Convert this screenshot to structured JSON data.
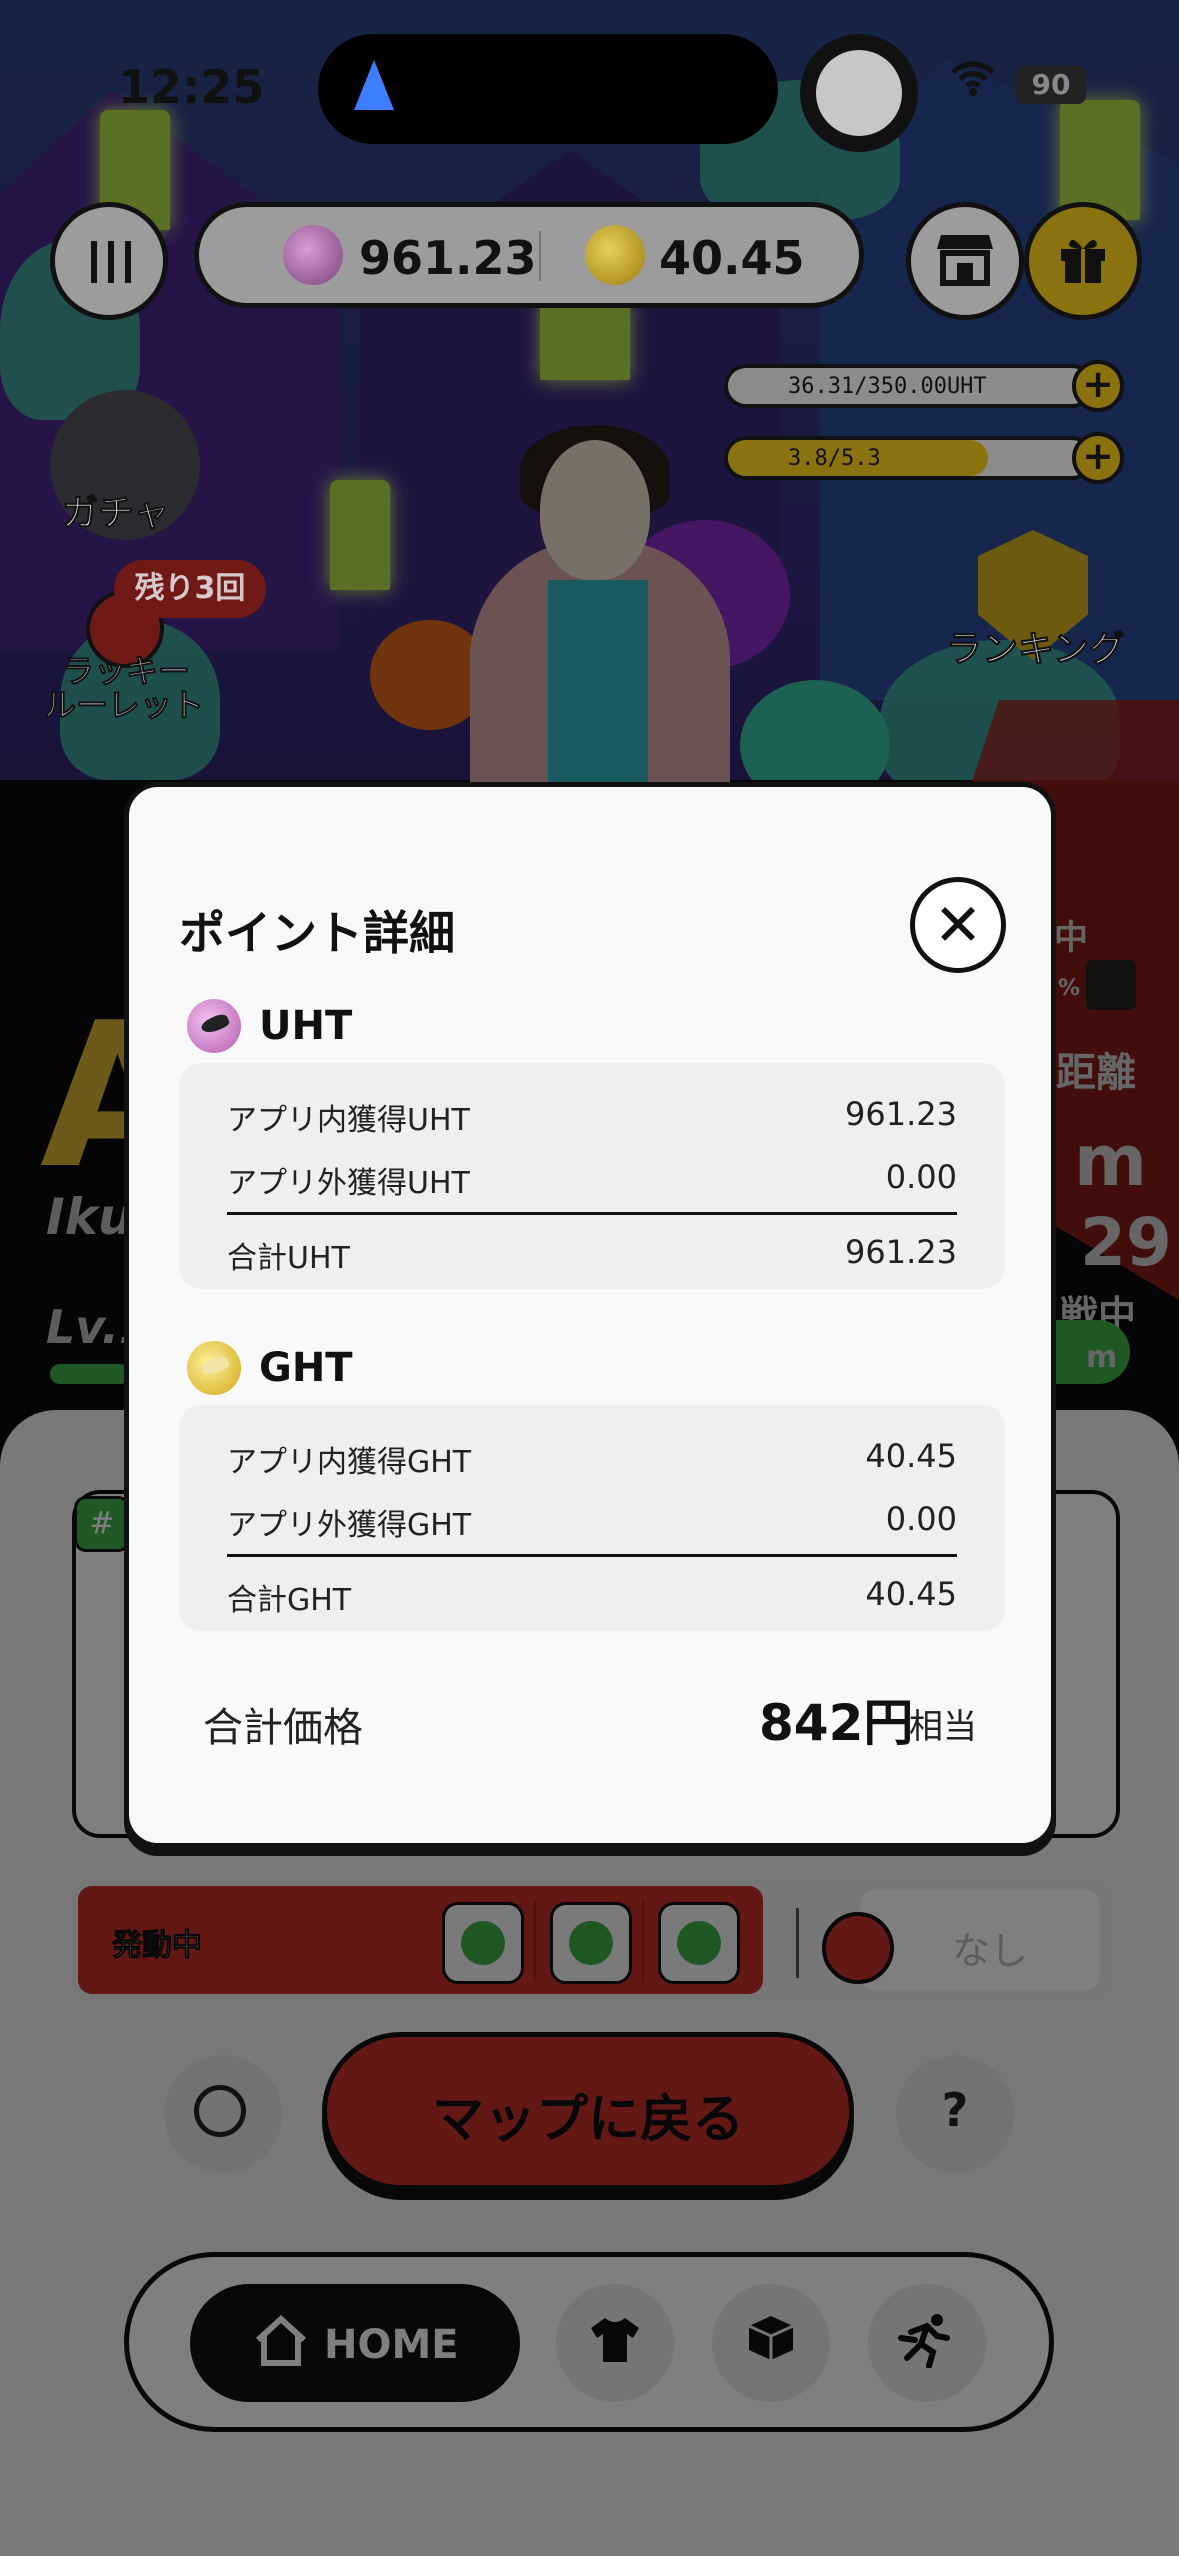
{
  "status_bar": {
    "time": "12:25",
    "battery": "90"
  },
  "balances": {
    "uht": "961.23",
    "ght": "40.45"
  },
  "stats": {
    "uht_capacity": "36.31/350.00UHT",
    "energy": "3.8/5.3",
    "energy_fill_fraction": 0.717
  },
  "left_menu": {
    "gacha_label": "ガチャ",
    "remaining_badge": "残り3回",
    "lucky_roulette_line1": "ラッキー",
    "lucky_roulette_line2": "ルーレット"
  },
  "ranking_label": "ランキング",
  "background_partial": {
    "user_name_fragment": "Iku",
    "level_fragment": "Lv.1",
    "right_fragments": [
      "中",
      "%",
      "距離",
      "m",
      "29",
      "戦中",
      "m"
    ],
    "card_tag": "#"
  },
  "effects": {
    "active_label": "発動中",
    "none_label": "なし"
  },
  "main_button": {
    "map_label": "マップに戻る",
    "help_label": "?"
  },
  "bottom_nav": {
    "home_label": "HOME"
  },
  "modal": {
    "title": "ポイント詳細",
    "uht": {
      "heading": "UHT",
      "rows": [
        {
          "label": "アプリ内獲得UHT",
          "value": "961.23"
        },
        {
          "label": "アプリ外獲得UHT",
          "value": "0.00"
        }
      ],
      "total_label": "合計UHT",
      "total_value": "961.23"
    },
    "ght": {
      "heading": "GHT",
      "rows": [
        {
          "label": "アプリ内獲得GHT",
          "value": "40.45"
        },
        {
          "label": "アプリ外獲得GHT",
          "value": "0.00"
        }
      ],
      "total_label": "合計GHT",
      "total_value": "40.45"
    },
    "total_price_label": "合計価格",
    "total_price_value": "842円",
    "total_price_suffix": "相当"
  },
  "colors": {
    "accent_red": "#c8302c",
    "uht_coin": "#d69fd3",
    "ght_coin": "#e8cf5a"
  }
}
